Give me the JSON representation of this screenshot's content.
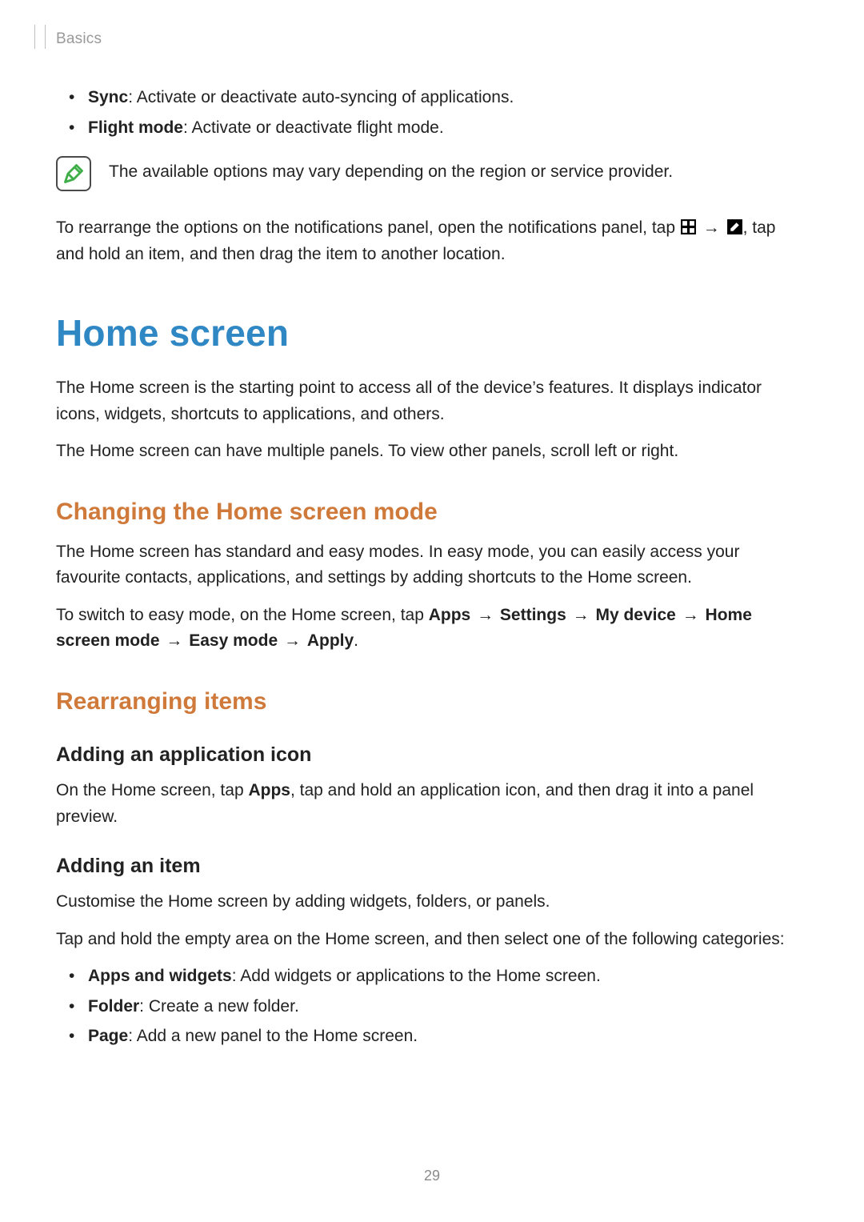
{
  "header": {
    "breadcrumb": "Basics"
  },
  "top_bullets": [
    {
      "label": "Sync",
      "desc": ": Activate or deactivate auto-syncing of applications."
    },
    {
      "label": "Flight mode",
      "desc": ": Activate or deactivate flight mode."
    }
  ],
  "note": {
    "icon": "note-pencil-icon",
    "text": "The available options may vary depending on the region or service provider."
  },
  "rearrange": {
    "p1_a": "To rearrange the options on the notifications panel, open the notifications panel, tap ",
    "arrow": "→",
    "p1_b": ", tap and hold an item, and then drag the item to another location.",
    "icon1": "grid-icon",
    "icon2": "edit-icon"
  },
  "home": {
    "title": "Home screen",
    "p1": "The Home screen is the starting point to access all of the device’s features. It displays indicator icons, widgets, shortcuts to applications, and others.",
    "p2": "The Home screen can have multiple panels. To view other panels, scroll left or right."
  },
  "changing": {
    "title": "Changing the Home screen mode",
    "p1": "The Home screen has standard and easy modes. In easy mode, you can easily access your favourite contacts, applications, and settings by adding shortcuts to the Home screen.",
    "p2_prefix": "To switch to easy mode, on the Home screen, tap ",
    "path": [
      "Apps",
      "Settings",
      "My device",
      "Home screen mode",
      "Easy mode",
      "Apply"
    ],
    "arrow": "→",
    "period": "."
  },
  "rearranging": {
    "title": "Rearranging items",
    "adding_app": {
      "title": "Adding an application icon",
      "p_prefix": "On the Home screen, tap ",
      "apps": "Apps",
      "p_suffix": ", tap and hold an application icon, and then drag it into a panel preview."
    },
    "adding_item": {
      "title": "Adding an item",
      "p1": "Customise the Home screen by adding widgets, folders, or panels.",
      "p2": "Tap and hold the empty area on the Home screen, and then select one of the following categories:",
      "bullets": [
        {
          "label": "Apps and widgets",
          "desc": ": Add widgets or applications to the Home screen."
        },
        {
          "label": "Folder",
          "desc": ": Create a new folder."
        },
        {
          "label": "Page",
          "desc": ": Add a new panel to the Home screen."
        }
      ]
    }
  },
  "page_number": "29"
}
